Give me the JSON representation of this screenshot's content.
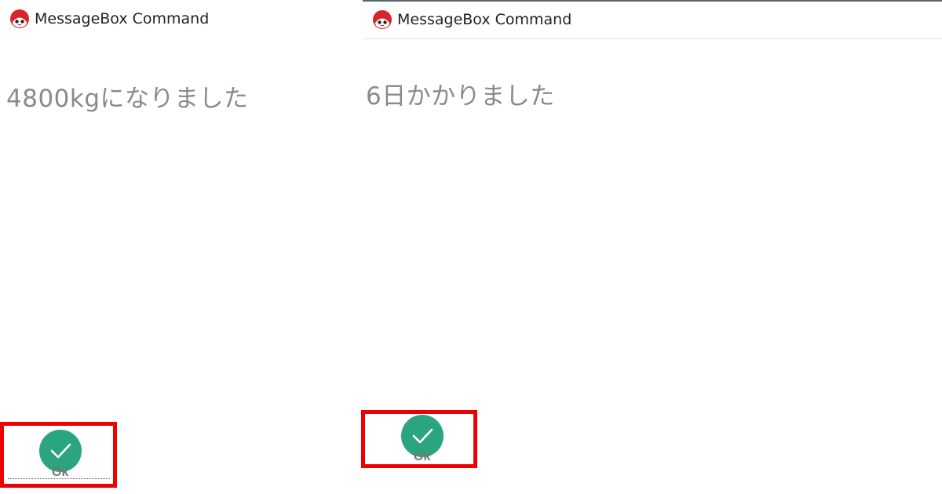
{
  "dialogs": [
    {
      "title": "MessageBox Command",
      "icon": "app-logo-icon",
      "message": "4800kgになりました",
      "ok_label": "Ok"
    },
    {
      "title": "MessageBox Command",
      "icon": "app-logo-icon",
      "message": "6日かかりました",
      "ok_label": "Ok"
    }
  ],
  "colors": {
    "ok_button": "#2ba57f",
    "highlight": "#ee0000",
    "message_text": "#8a8a8a",
    "icon_red": "#d7262b"
  }
}
